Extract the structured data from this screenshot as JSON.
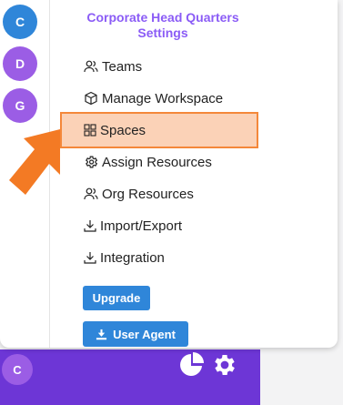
{
  "workspaces": [
    {
      "letter": "C",
      "color": "#2f86d9"
    },
    {
      "letter": "D",
      "color": "#9b5de5"
    },
    {
      "letter": "G",
      "color": "#9b5de5"
    }
  ],
  "panel": {
    "title_line1": "Corporate Head Quarters",
    "title_line2": "Settings"
  },
  "menu": [
    {
      "label": "Teams",
      "icon": "users-icon"
    },
    {
      "label": "Manage Workspace",
      "icon": "cube-icon"
    },
    {
      "label": "Spaces",
      "icon": "grid-icon",
      "highlighted": true
    },
    {
      "label": "Assign Resources",
      "icon": "gear-icon"
    },
    {
      "label": "Org Resources",
      "icon": "users-icon"
    },
    {
      "label": "Import/Export",
      "icon": "download-icon"
    },
    {
      "label": "Integration",
      "icon": "download-icon"
    }
  ],
  "buttons": {
    "upgrade": "Upgrade",
    "user_agent": "User Agent"
  },
  "bottom_bar": {
    "avatar_letter": "C"
  },
  "colors": {
    "accent_purple": "#8b5cf6",
    "button_blue": "#2f86d9",
    "highlight_fill": "#fbd2b7",
    "highlight_border": "#f4883a",
    "bar_purple": "#6d36d6"
  }
}
